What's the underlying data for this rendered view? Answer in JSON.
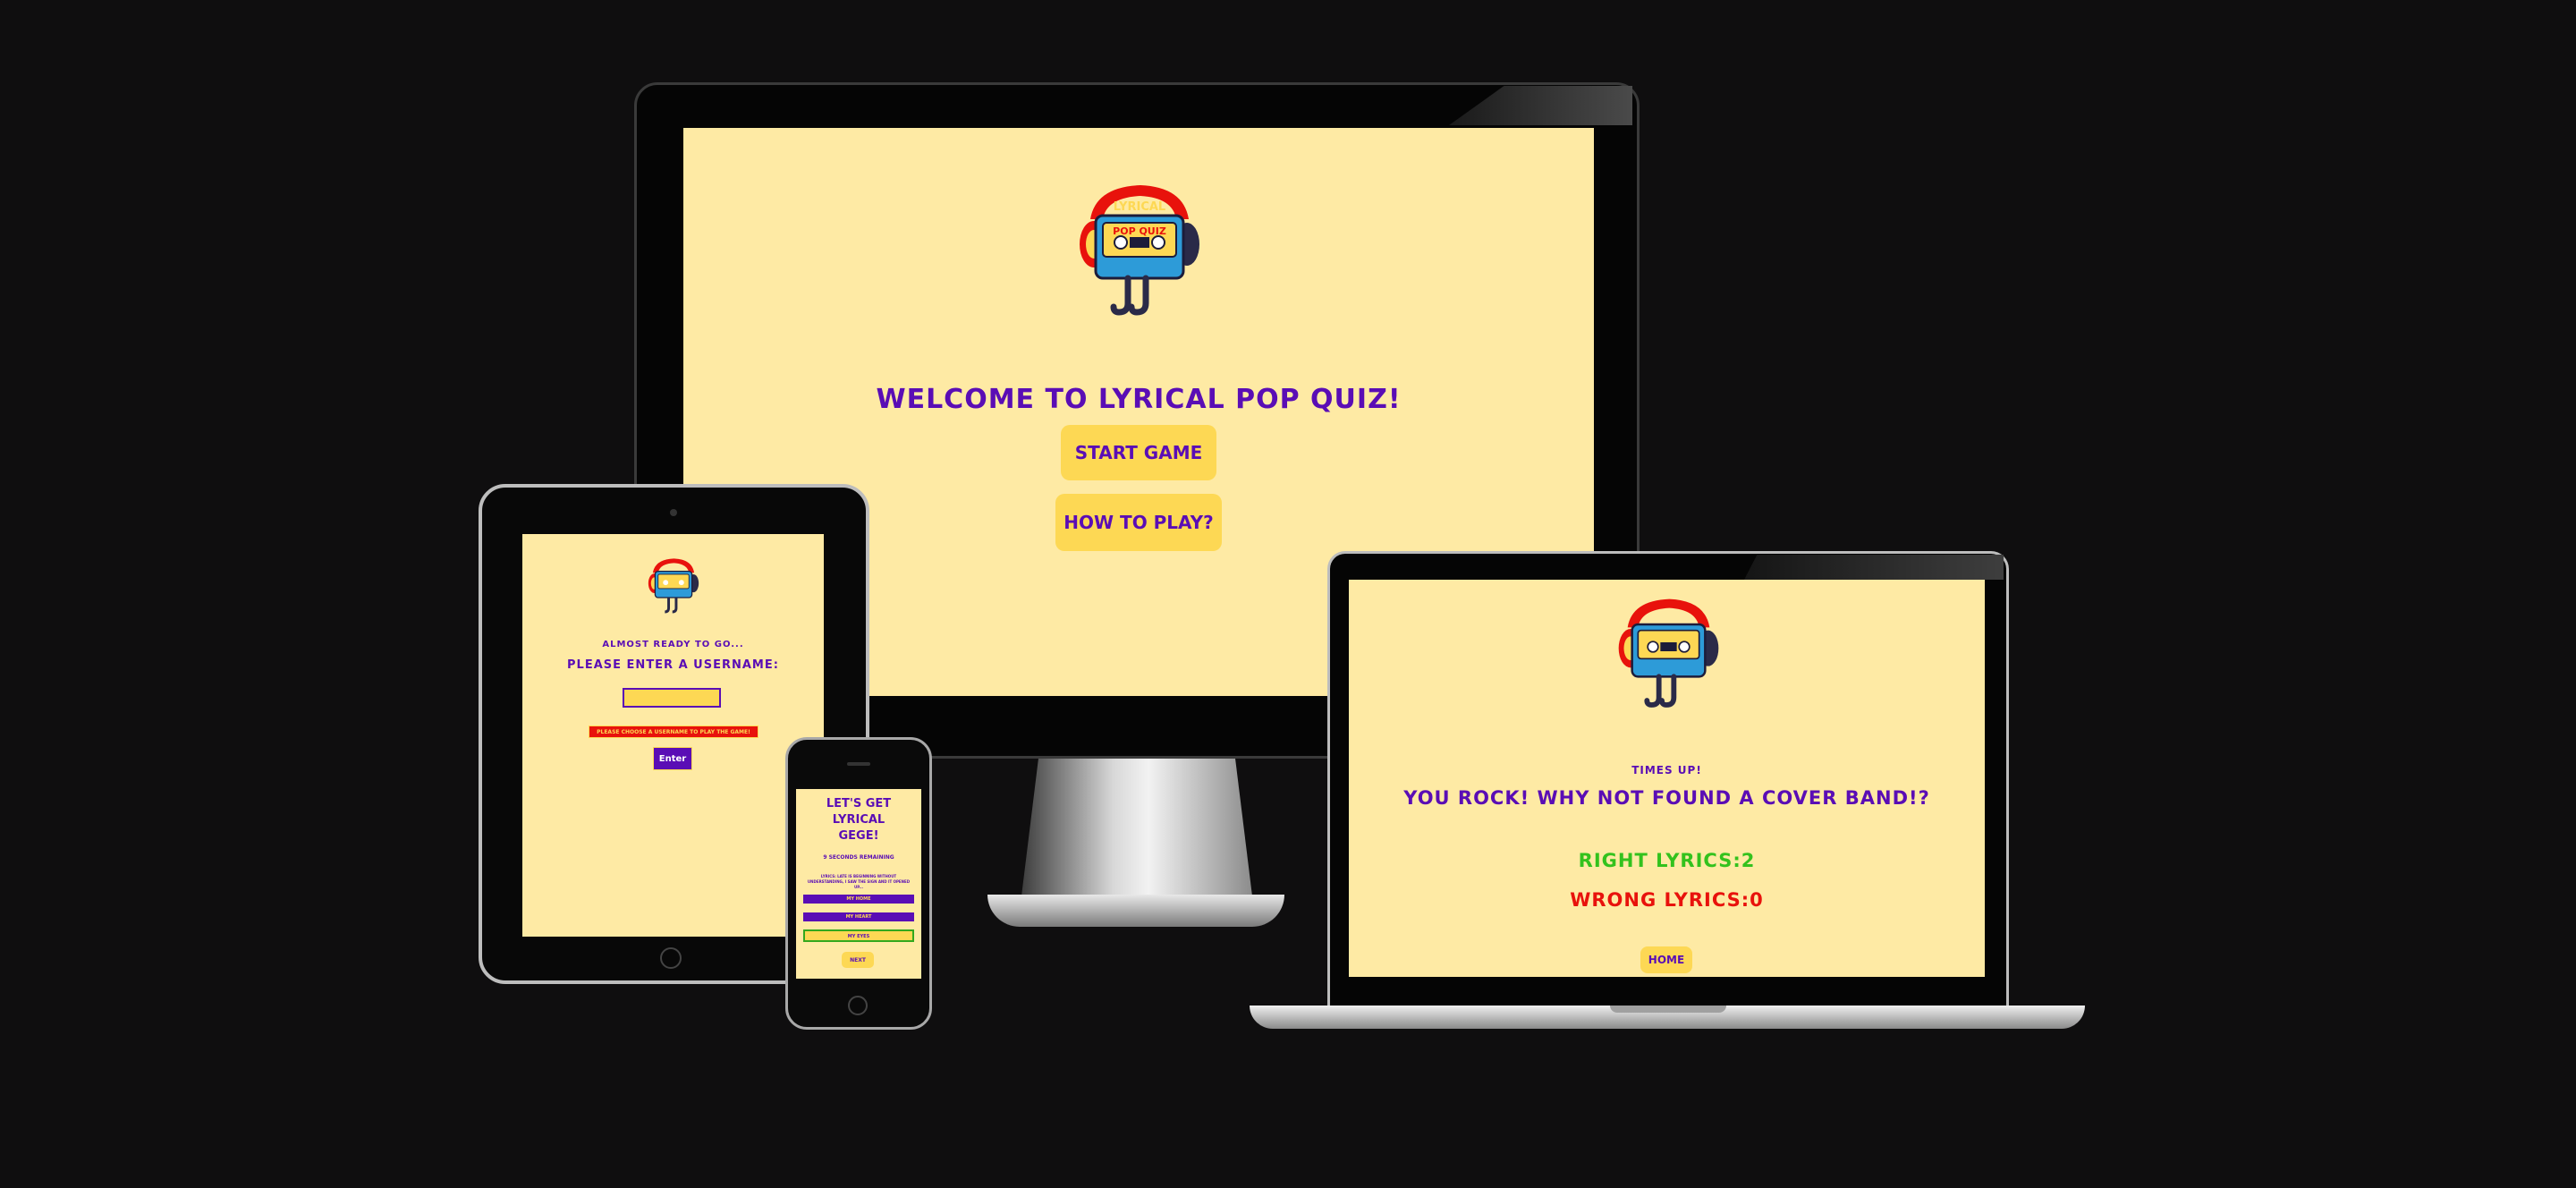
{
  "logo": {
    "line1": "LYRICAL",
    "line2": "POP QUIZ"
  },
  "desktop": {
    "heading": "WELCOME TO LYRICAL POP QUIZ!",
    "start_button": "START GAME",
    "how_button": "HOW TO PLAY?"
  },
  "tablet": {
    "subheading": "ALMOST READY TO GO...",
    "prompt": "PLEASE ENTER A USERNAME:",
    "username_value": "",
    "error": "PLEASE CHOOSE A USERNAME TO PLAY THE GAME!",
    "enter_button": "Enter"
  },
  "phone": {
    "title_lines": [
      "LET'S GET",
      "LYRICAL",
      "GEGE!"
    ],
    "timer": "9 SECONDS REMAINING",
    "question": "LYRICS: LATE IS BEGINNING WITHOUT UNDERSTANDING, I SAW THE SIGN AND IT OPENED UP...",
    "answers": [
      "MY HOME",
      "MY HEART",
      "MY EYES"
    ],
    "next_button": "NEXT"
  },
  "laptop": {
    "times_up": "TIMES UP!",
    "message": "YOU ROCK! WHY NOT FOUND A COVER BAND!?",
    "right": "RIGHT LYRICS:2",
    "wrong": "WRONG LYRICS:0",
    "home_button": "HOME"
  },
  "colors": {
    "screen_bg": "#feeaa4",
    "accent_purple": "#5a0db5",
    "button_yellow": "#fdd854",
    "right_green": "#33c21d",
    "wrong_red": "#e8120c"
  }
}
